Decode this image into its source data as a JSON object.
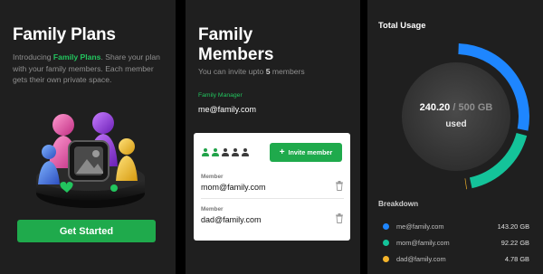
{
  "plans": {
    "title": "Family Plans",
    "intro_prefix": "Introducing ",
    "intro_highlight": "Family Plans",
    "intro_suffix": ".",
    "description": "Share your plan with your family members. Each member gets their own private space.",
    "cta_label": "Get Started"
  },
  "members": {
    "title_line1": "Family",
    "title_line2": "Members",
    "invite_prefix": "You can invite upto ",
    "invite_count": "5",
    "invite_suffix": " members",
    "manager_label": "Family Manager",
    "manager_email": "me@family.com",
    "slots_total": 5,
    "slots_used": 2,
    "invite_button_label": "Invite member",
    "list": [
      {
        "label": "Member",
        "email": "mom@family.com"
      },
      {
        "label": "Member",
        "email": "dad@family.com"
      }
    ]
  },
  "usage": {
    "title": "Total Usage",
    "used": "240.20",
    "separator": " / ",
    "total": "500 GB",
    "used_label": "used",
    "breakdown_title": "Breakdown",
    "breakdown": [
      {
        "email": "me@family.com",
        "value": "143.20 GB",
        "gb": 143.2,
        "color": "#1e86ff"
      },
      {
        "email": "mom@family.com",
        "value": "92.22 GB",
        "gb": 92.22,
        "color": "#14c39a"
      },
      {
        "email": "dad@family.com",
        "value": "4.78 GB",
        "gb": 4.78,
        "color": "#f5b42b"
      }
    ],
    "total_gb": 500
  },
  "colors": {
    "accent": "#1faa4c",
    "panel_bg": "#1f1f1f"
  }
}
